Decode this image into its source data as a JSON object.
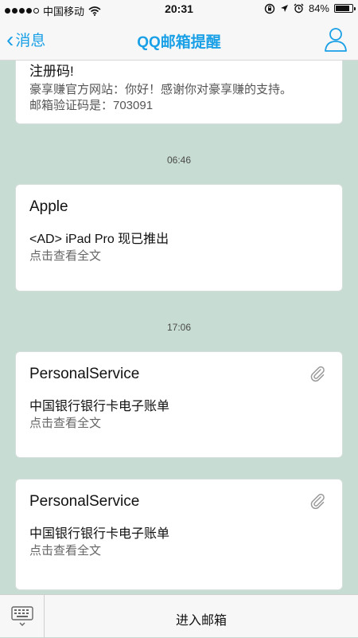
{
  "status_bar": {
    "carrier": "中国移动",
    "time": "20:31",
    "battery": "84%",
    "battery_level": 0.84
  },
  "nav": {
    "back_label": "消息",
    "title": "QQ邮箱提醒"
  },
  "messages": [
    {
      "sender": "注册码!",
      "body": "豪享赚官方网站：你好！感谢你对豪享赚的支持。",
      "code_line": "邮箱验证码是：703091"
    },
    {
      "timestamp": "06:46",
      "sender": "Apple",
      "subject": "<AD> iPad Pro 现已推出",
      "hint": "点击查看全文",
      "attachment": false
    },
    {
      "timestamp": "17:06",
      "sender": "PersonalService",
      "subject": "中国银行银行卡电子账单",
      "hint": "点击查看全文",
      "attachment": true
    },
    {
      "sender": "PersonalService",
      "subject": "中国银行银行卡电子账单",
      "hint": "点击查看全文",
      "attachment": true
    }
  ],
  "bottom_bar": {
    "enter_mailbox": "进入邮箱"
  },
  "colors": {
    "accent": "#1aa0e6",
    "background": "#c7dcd3"
  }
}
